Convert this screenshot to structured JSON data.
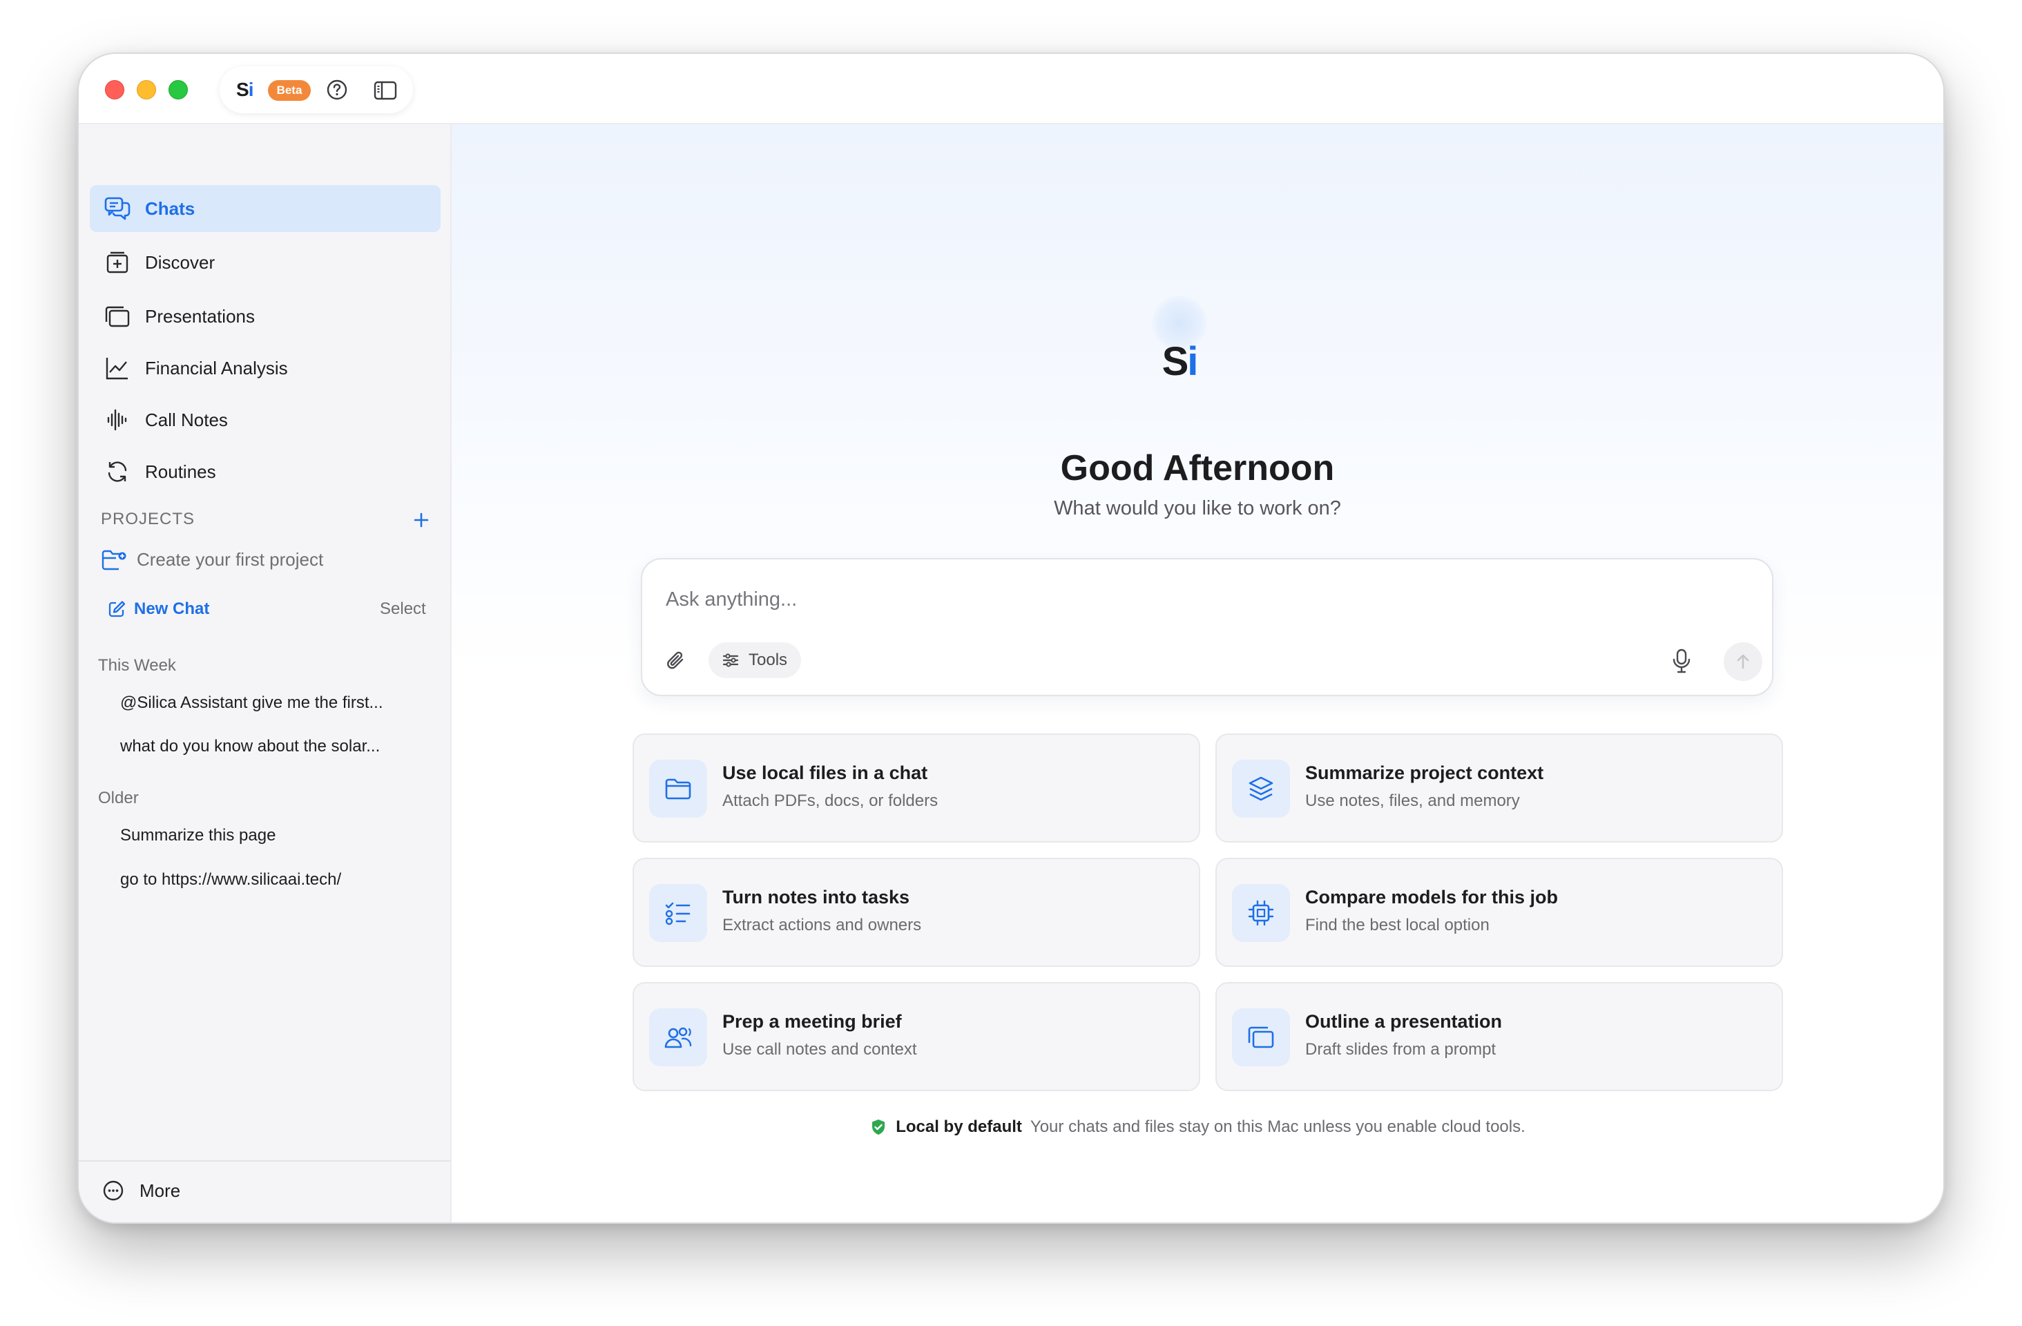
{
  "titlebar": {
    "brand": "Si",
    "brand_letter_s": "S",
    "brand_letter_i": "i",
    "beta_badge": "Beta",
    "icons": [
      "help-circle-icon",
      "sidebar-toggle-icon"
    ]
  },
  "sidebar": {
    "nav": [
      {
        "label": "Chats",
        "icon": "chat-bubbles-icon",
        "active": true
      },
      {
        "label": "Discover",
        "icon": "discover-icon",
        "active": false
      },
      {
        "label": "Presentations",
        "icon": "presentation-icon",
        "active": false
      },
      {
        "label": "Financial Analysis",
        "icon": "chart-line-icon",
        "active": false
      },
      {
        "label": "Call Notes",
        "icon": "waveform-icon",
        "active": false
      },
      {
        "label": "Routines",
        "icon": "refresh-icon",
        "active": false
      }
    ],
    "projects_header": "PROJECTS",
    "create_project": "Create your first project",
    "new_chat": "New Chat",
    "select": "Select",
    "groups": [
      {
        "label": "This Week",
        "items": [
          "@Silica Assistant give me the first...",
          "what do you know about the solar..."
        ]
      },
      {
        "label": "Older",
        "items": [
          "Summarize this page",
          "go to https://www.silicaai.tech/"
        ]
      }
    ],
    "more": "More"
  },
  "main": {
    "greeting": "Good Afternoon",
    "subtitle": "What would you like to work on?",
    "composer": {
      "placeholder": "Ask anything...",
      "tools_label": "Tools"
    },
    "cards": [
      {
        "title": "Use local files in a chat",
        "desc": "Attach PDFs, docs, or folders",
        "icon": "folder-icon"
      },
      {
        "title": "Summarize project context",
        "desc": "Use notes, files, and memory",
        "icon": "layers-icon"
      },
      {
        "title": "Turn notes into tasks",
        "desc": "Extract actions and owners",
        "icon": "checklist-icon"
      },
      {
        "title": "Compare models for this job",
        "desc": "Find the best local option",
        "icon": "chip-icon"
      },
      {
        "title": "Prep a meeting brief",
        "desc": "Use call notes and context",
        "icon": "people-icon"
      },
      {
        "title": "Outline a presentation",
        "desc": "Draft slides from a prompt",
        "icon": "slides-icon"
      }
    ],
    "footer": {
      "strong": "Local by default",
      "text": "Your chats and files stay on this Mac unless you enable cloud tools."
    }
  },
  "colors": {
    "accent": "#1e6fe8",
    "sidebar_bg": "#f5f5f7",
    "active_nav_bg": "#d9e8fb",
    "beta_badge": "#f2893a",
    "shield_green": "#2ea84f"
  }
}
